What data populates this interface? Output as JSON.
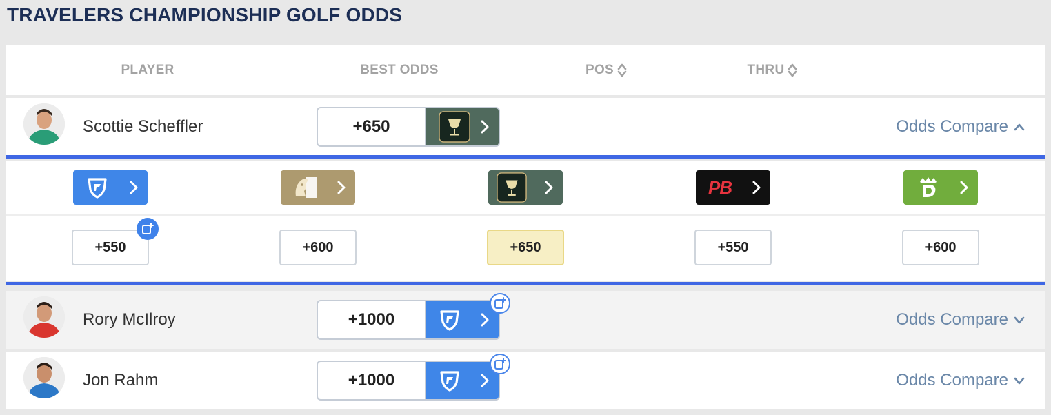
{
  "title": "TRAVELERS CHAMPIONSHIP GOLF ODDS",
  "columns": {
    "player": "PLAYER",
    "best_odds": "BEST ODDS",
    "pos": "POS",
    "thru": "THRU"
  },
  "players": [
    {
      "name": "Scottie Scheffler",
      "best_odds": "+650",
      "best_book_icon": "chalice-book-icon",
      "compare_label": "Odds Compare",
      "expanded": true,
      "shirt_color": "#2a9d77"
    },
    {
      "name": "Rory McIlroy",
      "best_odds": "+1000",
      "best_book_icon": "fanduel-shield-icon",
      "compare_label": "Odds Compare",
      "expanded": false,
      "shirt_color": "#d9362f"
    },
    {
      "name": "Jon Rahm",
      "best_odds": "+1000",
      "best_book_icon": "fanduel-shield-icon",
      "compare_label": "Odds Compare",
      "expanded": false,
      "shirt_color": "#2c78c7"
    }
  ],
  "sportsbooks": [
    {
      "icon": "fanduel-shield-icon",
      "color": "#3f86e8",
      "odds": "+550",
      "best": false
    },
    {
      "icon": "lion-logo-icon",
      "color": "#ad9a6f",
      "odds": "+600",
      "best": false
    },
    {
      "icon": "chalice-book-icon",
      "color": "#506a5d",
      "odds": "+650",
      "best": true
    },
    {
      "icon": "pb-logo-icon",
      "logo_text": "PB",
      "color": "#111111",
      "odds": "+550",
      "best": false
    },
    {
      "icon": "dk-crown-icon",
      "color": "#71ad3d",
      "odds": "+600",
      "best": false
    }
  ],
  "colors": {
    "title": "#1c2e55",
    "accent_blue": "#3f67e4",
    "compare_link": "#6a87a8",
    "best_highlight": "#f7efc5"
  }
}
